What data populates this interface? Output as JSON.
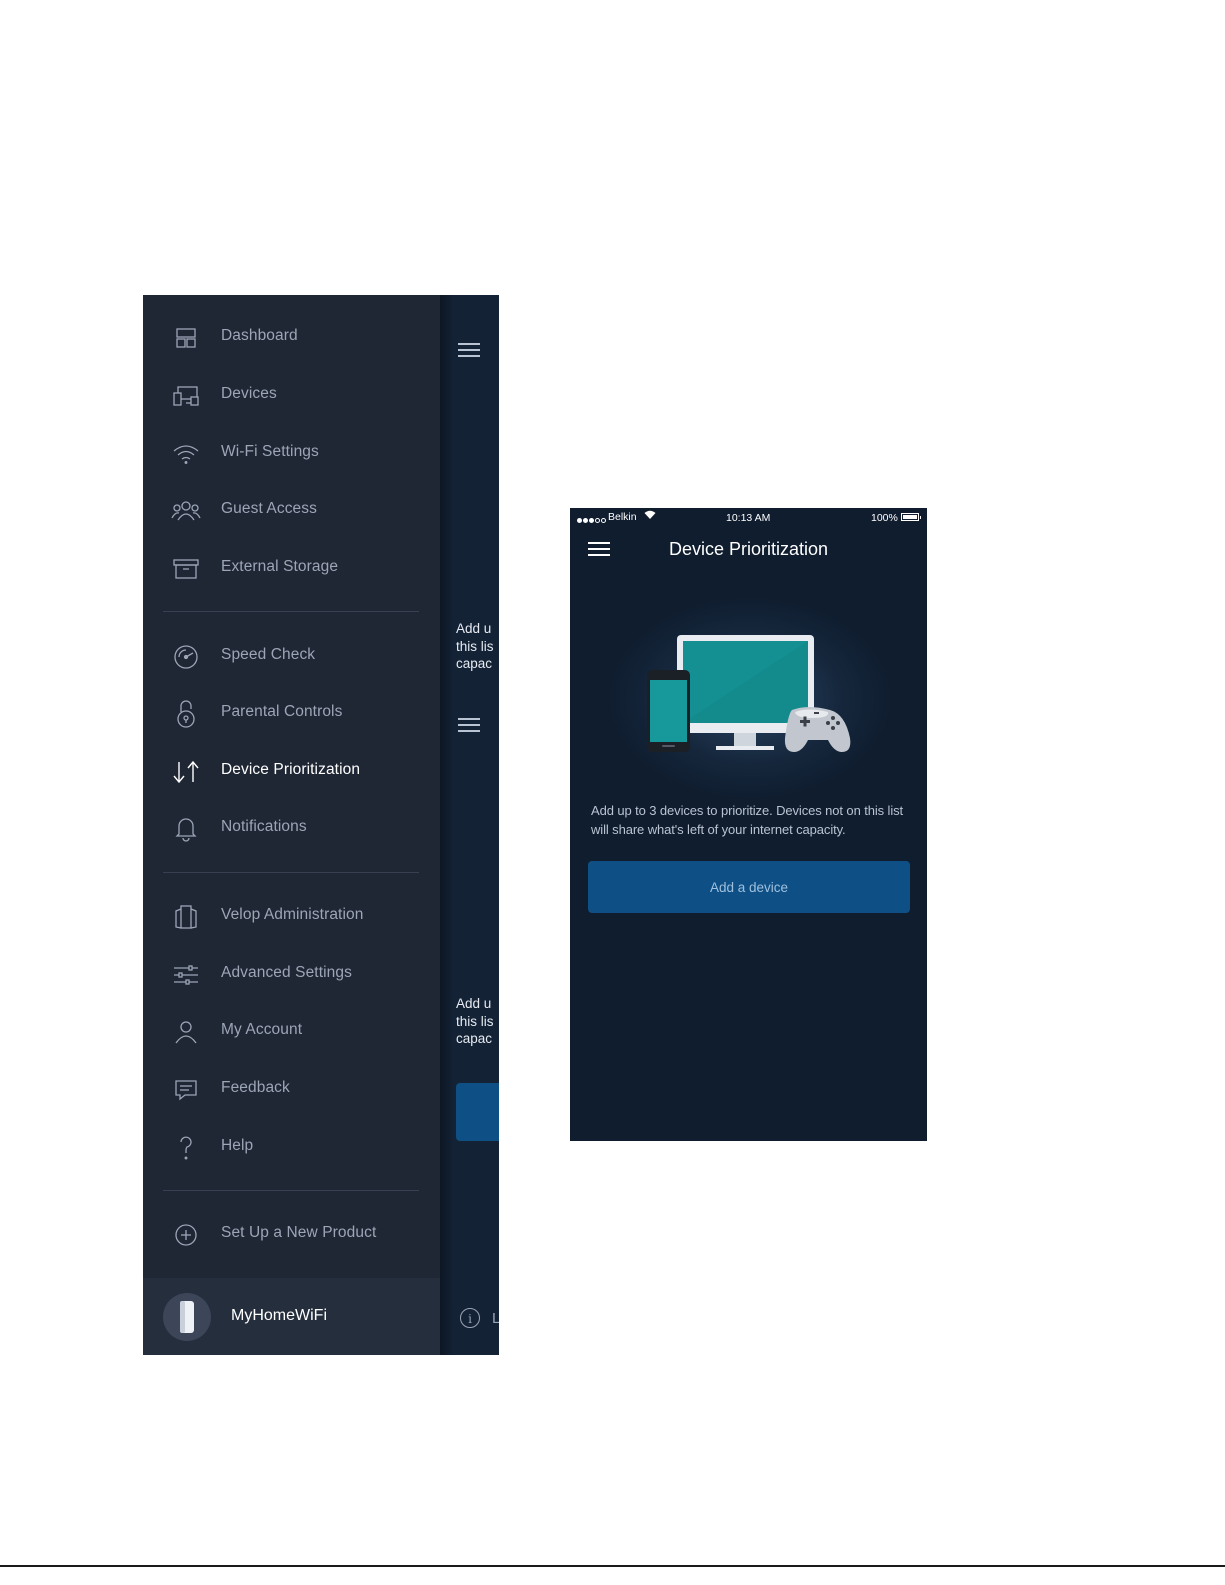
{
  "menu": {
    "items": [
      {
        "label": "Dashboard",
        "icon": "dashboard-icon"
      },
      {
        "label": "Devices",
        "icon": "devices-icon"
      },
      {
        "label": "Wi-Fi Settings",
        "icon": "wifi-icon"
      },
      {
        "label": "Guest Access",
        "icon": "guest-access-icon"
      },
      {
        "label": "External Storage",
        "icon": "external-storage-icon"
      },
      {
        "label": "Speed Check",
        "icon": "speed-check-icon"
      },
      {
        "label": "Parental Controls",
        "icon": "parental-controls-icon"
      },
      {
        "label": "Device Prioritization",
        "icon": "device-prioritization-icon",
        "active": true
      },
      {
        "label": "Notifications",
        "icon": "bell-icon"
      },
      {
        "label": "Velop Administration",
        "icon": "velop-icon"
      },
      {
        "label": "Advanced Settings",
        "icon": "sliders-icon"
      },
      {
        "label": "My Account",
        "icon": "account-icon"
      },
      {
        "label": "Feedback",
        "icon": "feedback-icon"
      },
      {
        "label": "Help",
        "icon": "help-icon"
      },
      {
        "label": "Set Up a New Product",
        "icon": "add-circle-icon"
      }
    ],
    "network_name": "MyHomeWiFi"
  },
  "behind_panel": {
    "text_top": [
      "Add u",
      "this lis",
      "capac"
    ],
    "text_bottom": [
      "Add u",
      "this lis",
      "capac"
    ],
    "footer_text": "L"
  },
  "phone": {
    "status_bar": {
      "carrier": "Belkin",
      "time": "10:13 AM",
      "battery": "100%"
    },
    "title": "Device Prioritization",
    "description": "Add up to 3 devices to prioritize. Devices not on this list will share what's left of your internet capacity.",
    "add_button_label": "Add a device"
  },
  "colors": {
    "menu_bg": "#1f2634",
    "active_text": "#ffffff",
    "inactive_text": "#9ca6b7",
    "phone_bg": "#0f1d2f",
    "button_bg": "#0e4f85",
    "teal_screen": "#138a8c"
  }
}
